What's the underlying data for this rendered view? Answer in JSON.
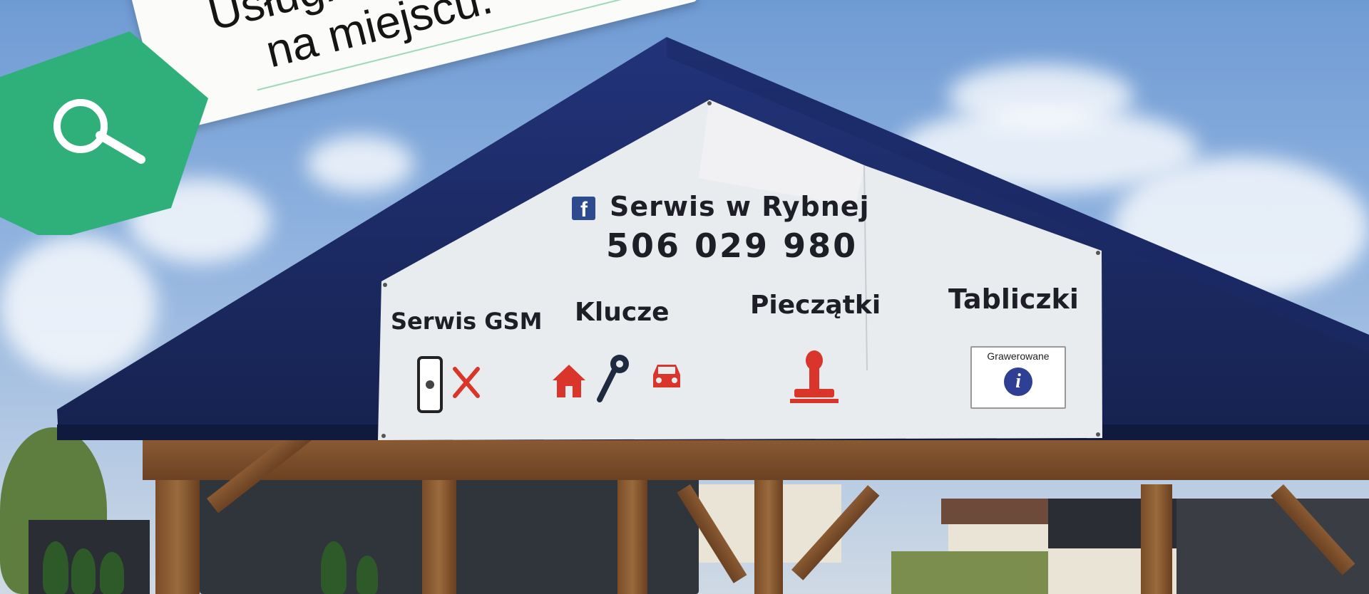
{
  "overlay": {
    "line1": "Usługi dost",
    "line2": "na miejscu.",
    "icon": "search-icon",
    "accent_color": "#2fb07a"
  },
  "banner": {
    "facebook_icon": "facebook-icon",
    "page_name": "Serwis w Rybnej",
    "phone": "506 029 980",
    "services": [
      {
        "label": "Serwis GSM",
        "icons": [
          "smartphone-icon",
          "tools-icon"
        ]
      },
      {
        "label": "Klucze",
        "icons": [
          "house-icon",
          "key-icon",
          "car-icon"
        ]
      },
      {
        "label": "Pieczątki",
        "icons": [
          "stamp-icon"
        ]
      },
      {
        "label": "Tabliczki",
        "icons": [
          "info-icon"
        ]
      }
    ],
    "plate_caption": "Grawerowane",
    "plate_symbol": "i",
    "icon_color": "#d9352a",
    "plate_color": "#2f3f93"
  },
  "colors": {
    "roof": "#1a2a63",
    "timber": "#7a4c28",
    "banner_bg": "#eceff2"
  }
}
